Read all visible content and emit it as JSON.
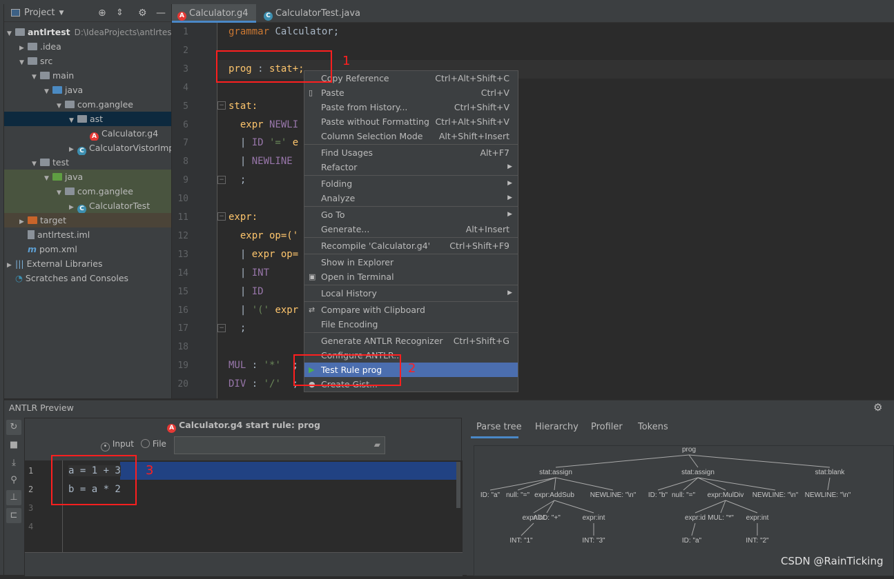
{
  "project_panel": {
    "title": "Project",
    "items": [
      {
        "label": "antlrtest",
        "path": "D:\\IdeaProjects\\antlrtest"
      },
      {
        "label": ".idea"
      },
      {
        "label": "src"
      },
      {
        "label": "main"
      },
      {
        "label": "java"
      },
      {
        "label": "com.ganglee"
      },
      {
        "label": "ast"
      },
      {
        "label": "Calculator.g4"
      },
      {
        "label": "CalculatorVistorImp"
      },
      {
        "label": "test"
      },
      {
        "label": "java"
      },
      {
        "label": "com.ganglee"
      },
      {
        "label": "CalculatorTest"
      },
      {
        "label": "target"
      },
      {
        "label": "antlrtest.iml"
      },
      {
        "label": "pom.xml"
      },
      {
        "label": "External Libraries"
      },
      {
        "label": "Scratches and Consoles"
      }
    ]
  },
  "tabs": [
    {
      "label": "Calculator.g4",
      "active": true
    },
    {
      "label": "CalculatorTest.java",
      "active": false
    }
  ],
  "editor": {
    "line_numbers": [
      "1",
      "2",
      "3",
      "4",
      "5",
      "6",
      "7",
      "8",
      "9",
      "10",
      "11",
      "12",
      "13",
      "14",
      "15",
      "16",
      "17",
      "18",
      "19",
      "20"
    ],
    "lines": {
      "l1a": "grammar",
      "l1b": " Calculator;",
      "l3a": "prog",
      "l3b": " : ",
      "l3c": "stat+;",
      "l5": "stat:",
      "l6a": "  expr ",
      "l6b": "NEWLI",
      "l7a": "  | ",
      "l7b": "ID",
      "l7c": " '='",
      "l7d": " e",
      "l8a": "  | ",
      "l8b": "NEWLINE",
      "l9": "  ;",
      "l11": "expr:",
      "l12": "  expr op=('",
      "l13a": "  | ",
      "l13b": "expr op=",
      "l14a": "  | ",
      "l14b": "INT",
      "l15a": "  | ",
      "l15b": "ID",
      "l16a": "  | ",
      "l16b": "'('",
      "l16c": " expr",
      "l17": "  ;",
      "l19a": "MUL",
      "l19b": " : ",
      "l19c": "'*'",
      "l19d": "  ;",
      "l20a": "DIV",
      "l20b": " : ",
      "l20c": "'/'",
      "l20d": "  ;"
    }
  },
  "context_menu": {
    "items": [
      {
        "label": "Copy Reference",
        "shortcut": "Ctrl+Alt+Shift+C"
      },
      {
        "label": "Paste",
        "shortcut": "Ctrl+V"
      },
      {
        "label": "Paste from History...",
        "shortcut": "Ctrl+Shift+V"
      },
      {
        "label": "Paste without Formatting",
        "shortcut": "Ctrl+Alt+Shift+V"
      },
      {
        "label": "Column Selection Mode",
        "shortcut": "Alt+Shift+Insert"
      },
      {
        "label": "Find Usages",
        "shortcut": "Alt+F7"
      },
      {
        "label": "Refactor",
        "shortcut": ""
      },
      {
        "label": "Folding",
        "shortcut": ""
      },
      {
        "label": "Analyze",
        "shortcut": ""
      },
      {
        "label": "Go To",
        "shortcut": ""
      },
      {
        "label": "Generate...",
        "shortcut": "Alt+Insert"
      },
      {
        "label": "Recompile 'Calculator.g4'",
        "shortcut": "Ctrl+Shift+F9"
      },
      {
        "label": "Show in Explorer",
        "shortcut": ""
      },
      {
        "label": "Open in Terminal",
        "shortcut": ""
      },
      {
        "label": "Local History",
        "shortcut": ""
      },
      {
        "label": "Compare with Clipboard",
        "shortcut": ""
      },
      {
        "label": "File Encoding",
        "shortcut": ""
      },
      {
        "label": "Generate ANTLR Recognizer",
        "shortcut": "Ctrl+Shift+G"
      },
      {
        "label": "Configure ANTLR...",
        "shortcut": ""
      },
      {
        "label": "Test Rule prog",
        "shortcut": "",
        "selected": true
      },
      {
        "label": "Create Gist...",
        "shortcut": ""
      }
    ]
  },
  "annotations": {
    "n1": "1",
    "n2": "2",
    "n3": "3"
  },
  "antlr_preview": {
    "title": "ANTLR Preview",
    "header": "Calculator.g4 start rule: prog",
    "radio_input": "Input",
    "radio_file": "File",
    "selected_source": "Input",
    "input_line_numbers": [
      "1",
      "2",
      "3",
      "4"
    ],
    "input_lines": [
      "a = 1 + 3",
      "b = a * 2"
    ],
    "tabs": [
      "Parse tree",
      "Hierarchy",
      "Profiler",
      "Tokens"
    ],
    "active_tab": "Parse tree",
    "parse_tree": {
      "label": "prog",
      "children": [
        {
          "label": "stat:assign",
          "children": [
            {
              "label": "ID: \"a\""
            },
            {
              "label": "null: \"=\""
            },
            {
              "label": "expr:AddSub",
              "children": [
                {
                  "label": "expr:int",
                  "children": [
                    {
                      "label": "INT: \"1\""
                    }
                  ]
                },
                {
                  "label": "ADD: \"+\""
                },
                {
                  "label": "expr:int",
                  "children": [
                    {
                      "label": "INT: \"3\""
                    }
                  ]
                }
              ]
            },
            {
              "label": "NEWLINE: \"\\n\""
            }
          ]
        },
        {
          "label": "stat:assign",
          "children": [
            {
              "label": "ID: \"b\""
            },
            {
              "label": "null: \"=\""
            },
            {
              "label": "expr:MulDiv",
              "children": [
                {
                  "label": "expr:id",
                  "children": [
                    {
                      "label": "ID: \"a\""
                    }
                  ]
                },
                {
                  "label": "MUL: \"*\""
                },
                {
                  "label": "expr:int",
                  "children": [
                    {
                      "label": "INT: \"2\""
                    }
                  ]
                }
              ]
            },
            {
              "label": "NEWLINE: \"\\n\""
            }
          ]
        },
        {
          "label": "stat:blank",
          "children": [
            {
              "label": "NEWLINE: \"\\n\""
            }
          ]
        }
      ]
    }
  },
  "watermark": "CSDN @RainTicking",
  "colors": {
    "selection": "#4b6eaf",
    "annotation": "#ff1f1f",
    "tab_underline": "#4a88c7",
    "antlr_icon": "#e53935"
  }
}
